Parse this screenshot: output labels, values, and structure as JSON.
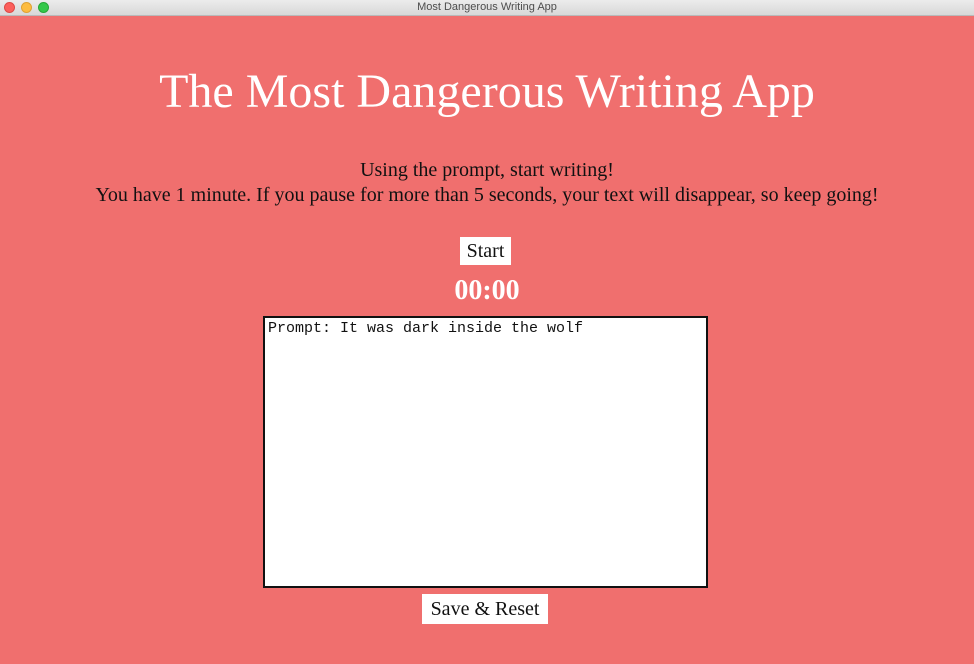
{
  "window": {
    "title": "Most Dangerous Writing App"
  },
  "app": {
    "title": "The Most Dangerous Writing App",
    "instruction_line1": "Using the prompt, start writing!",
    "instruction_line2": "You have 1 minute. If you pause for more than 5 seconds, your text will disappear, so keep going!",
    "start_label": "Start",
    "timer": "00:00",
    "editor_text": "Prompt: It was dark inside the wolf",
    "save_label": "Save & Reset"
  },
  "colors": {
    "background": "#f06f6e",
    "title_text": "#ffffff",
    "body_text": "#111111"
  }
}
